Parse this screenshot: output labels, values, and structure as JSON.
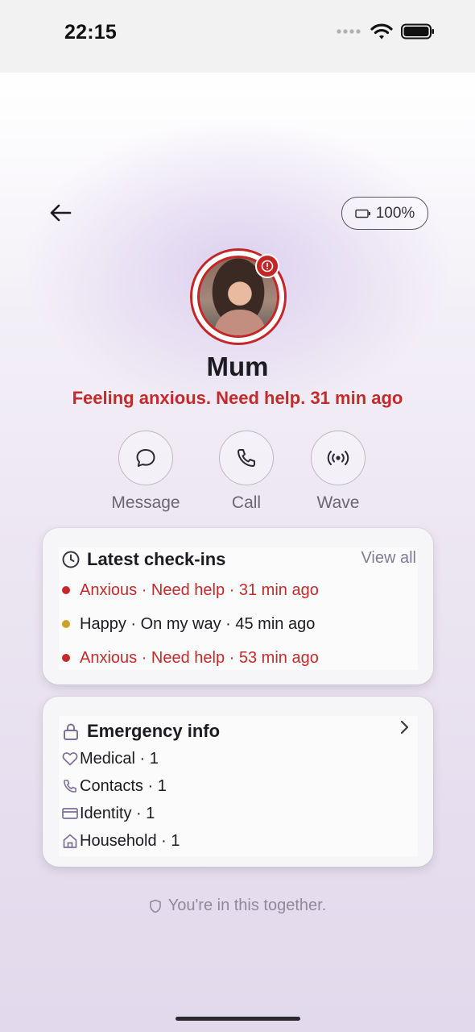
{
  "status_bar": {
    "time": "22:15"
  },
  "header": {
    "battery": "100%"
  },
  "profile": {
    "name": "Mum",
    "status": "Feeling anxious. Need help. 31 min ago"
  },
  "actions": [
    {
      "label": "Message",
      "icon": "message-icon"
    },
    {
      "label": "Call",
      "icon": "phone-icon"
    },
    {
      "label": "Wave",
      "icon": "wave-icon"
    }
  ],
  "checkins": {
    "title": "Latest check-ins",
    "view_all": "View all",
    "items": [
      {
        "text": "Anxious · Need help · 31 min ago",
        "color": "#c42a2a",
        "dot": "#c42a2a"
      },
      {
        "text": "Happy · On my way · 45 min ago",
        "color": "#1c1b22",
        "dot": "#c9a227"
      },
      {
        "text": "Anxious · Need help · 53 min ago",
        "color": "#c42a2a",
        "dot": "#c42a2a"
      }
    ]
  },
  "emergency": {
    "title": "Emergency info",
    "items": [
      {
        "label": "Medical · 1",
        "icon": "heart-icon"
      },
      {
        "label": "Contacts · 1",
        "icon": "phone-icon"
      },
      {
        "label": "Identity · 1",
        "icon": "id-card-icon"
      },
      {
        "label": "Household · 1",
        "icon": "home-icon"
      }
    ]
  },
  "footer": {
    "note": "You're in this together."
  },
  "colors": {
    "alert": "#c42a2a",
    "muted": "#827a95"
  }
}
